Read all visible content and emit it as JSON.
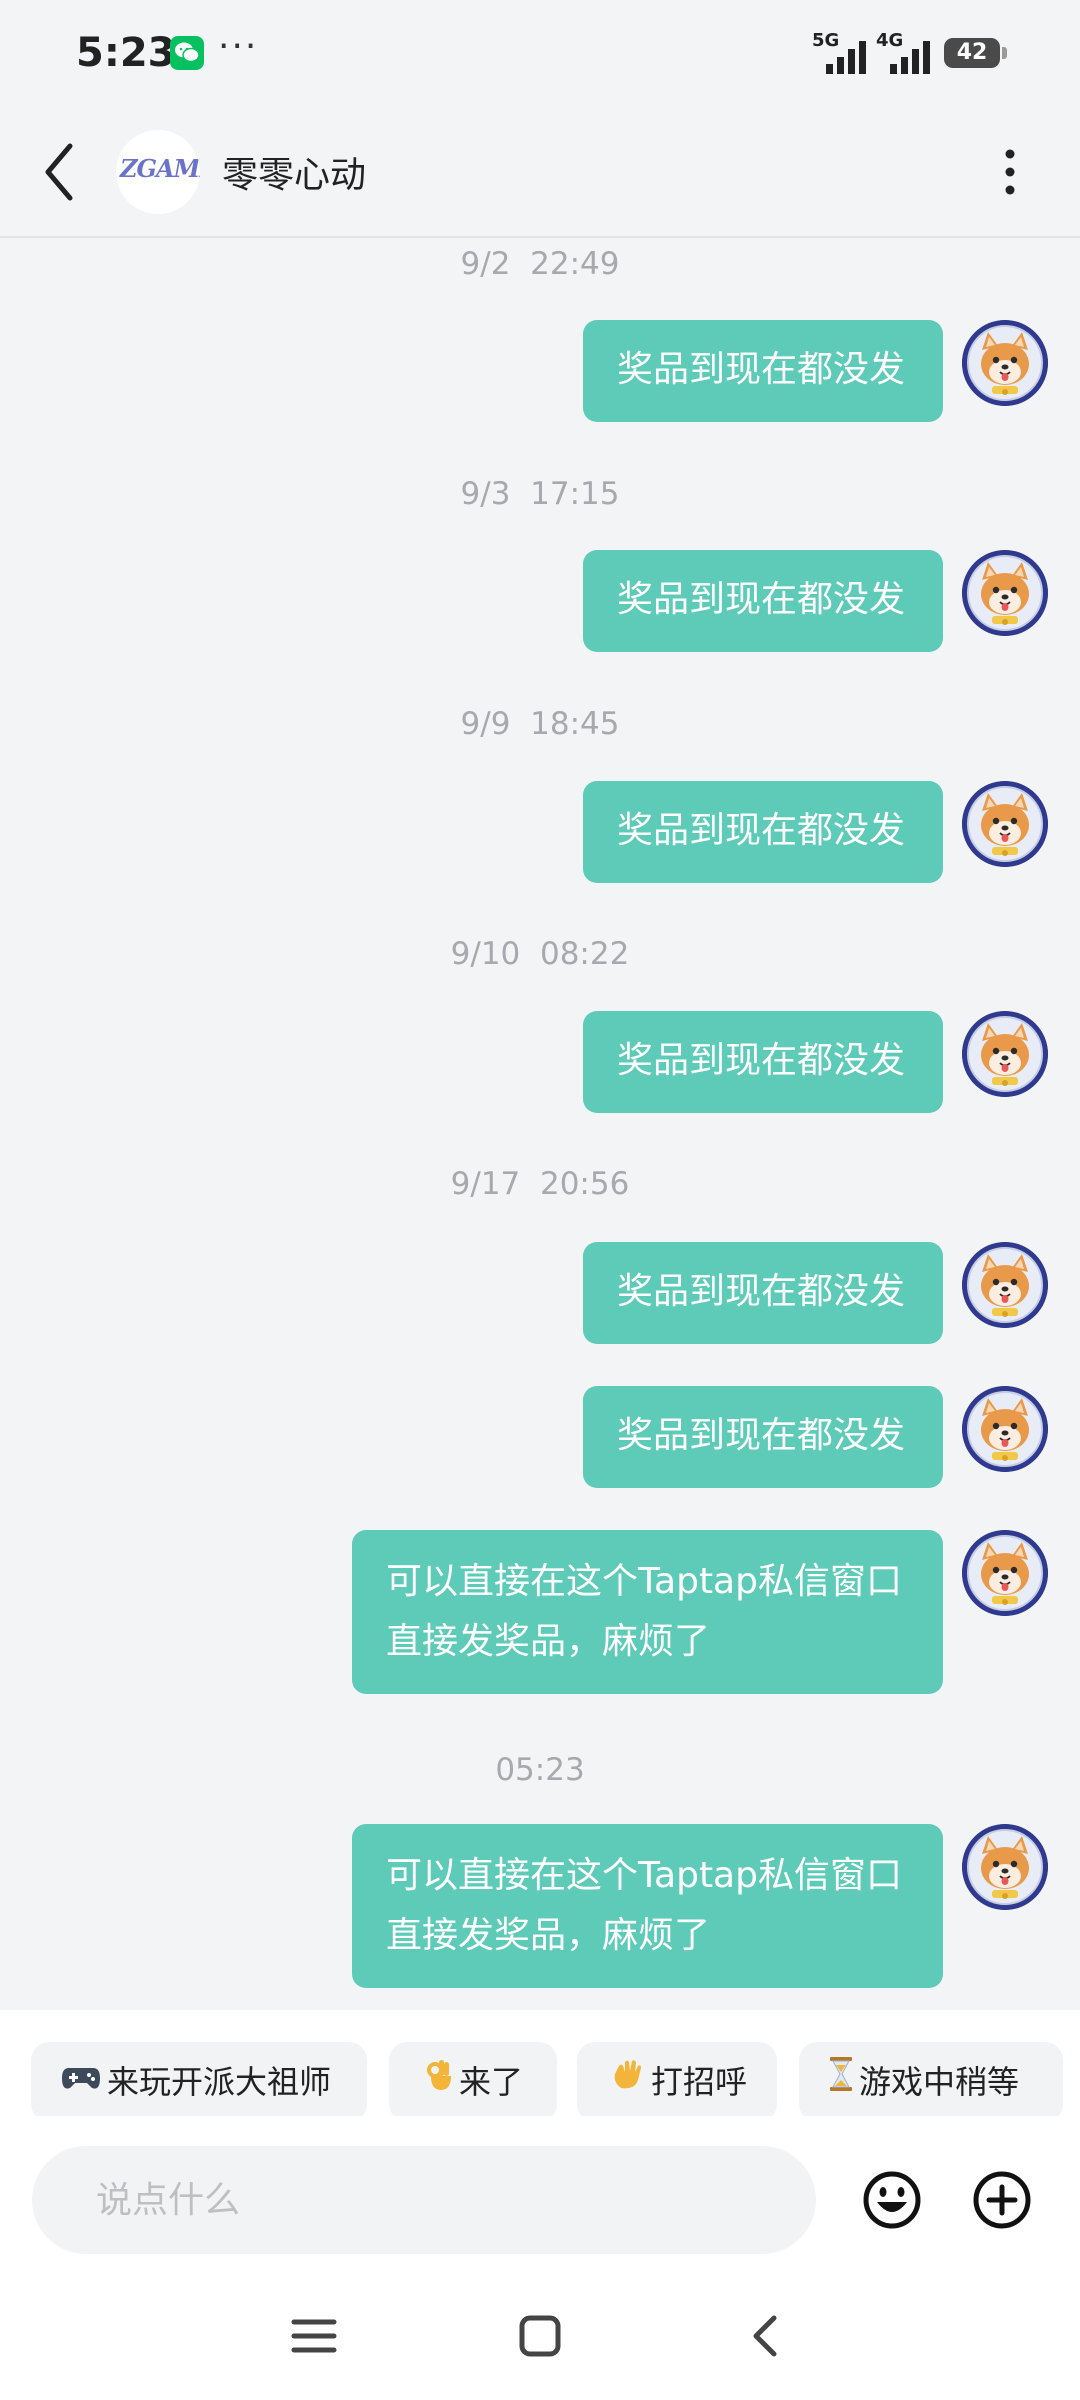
{
  "status_bar": {
    "time": "5:23",
    "more_indicator": "···",
    "network_1": "5G",
    "network_2": "4G",
    "battery_level": "42",
    "icons": [
      "wechat-notification-icon",
      "signal-icon",
      "battery-icon"
    ]
  },
  "header": {
    "title": "零零心动",
    "avatar_logo_text": "ZGAME",
    "icons": [
      "back-arrow-icon",
      "more-vertical-icon"
    ]
  },
  "messages": [
    {
      "timestamp": "9/2  22:49",
      "bubbles": [
        "奖品到现在都没发"
      ]
    },
    {
      "timestamp": "9/3  17:15",
      "bubbles": [
        "奖品到现在都没发"
      ]
    },
    {
      "timestamp": "9/9  18:45",
      "bubbles": [
        "奖品到现在都没发"
      ]
    },
    {
      "timestamp": "9/10  08:22",
      "bubbles": [
        "奖品到现在都没发"
      ]
    },
    {
      "timestamp": "9/17  20:56",
      "bubbles": [
        "奖品到现在都没发",
        "奖品到现在都没发",
        "可以直接在这个Taptap私信窗口直接发奖品，麻烦了"
      ]
    },
    {
      "timestamp": "05:23",
      "bubbles": [
        "可以直接在这个Taptap私信窗口直接发奖品，麻烦了"
      ]
    }
  ],
  "colors": {
    "bubble": "#5ecbb8",
    "background": "#f3f4f6",
    "timestamp": "#a6a9ae"
  },
  "quick_replies": [
    {
      "icon": "gamepad-icon",
      "label": "来玩开派大祖师"
    },
    {
      "icon": "ok-hand-icon",
      "label": "来了"
    },
    {
      "icon": "waving-hand-icon",
      "label": "打招呼"
    },
    {
      "icon": "hourglass-icon",
      "label": "游戏中稍等"
    }
  ],
  "input": {
    "placeholder": "说点什么",
    "icons": [
      "emoji-icon",
      "add-circle-icon"
    ]
  },
  "nav_bar": {
    "icons": [
      "menu-icon",
      "home-icon",
      "back-icon"
    ]
  }
}
